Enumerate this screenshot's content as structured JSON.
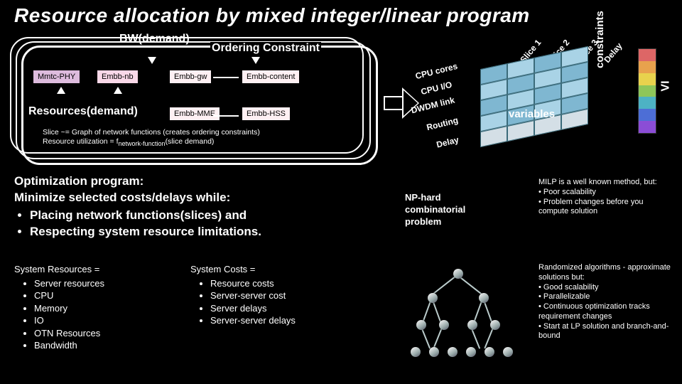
{
  "title": "Resource allocation by mixed integer/linear program",
  "panel": {
    "bw_label": "BW(demand)",
    "ordering_label": "Ordering Constraint",
    "resources_label": "Resources(demand)",
    "nodes": {
      "mmtc": "Mmtc-PHY",
      "nb": "Embb-nb",
      "gw": "Embb-gw",
      "content": "Embb-content",
      "mme": "Embb-MME",
      "hss": "Embb-HSS"
    },
    "note_line1": "Slice ~= Graph of network functions (creates ordering constraints)",
    "note_line2_a": "Resource utilization = f",
    "note_line2_sub": "network-function",
    "note_line2_b": "(slice demand)"
  },
  "grid3d": {
    "cols": {
      "s1": "Slice 1",
      "s2": "Slice 2",
      "s3": "Slice 3",
      "delay": "Delay"
    },
    "rows": {
      "r1": "CPU cores",
      "r2": "CPU I/O",
      "r3": "DWDM link",
      "r4": "Routing",
      "r5": "Delay"
    },
    "variables": "variables",
    "constraints": "constraints",
    "vi": "VI"
  },
  "opt": {
    "heading1": "Optimization program:",
    "heading2": "Minimize selected costs/delays while:",
    "b1": "Placing network functions(slices) and",
    "b2": "Respecting system resource limitations."
  },
  "sysres": {
    "title": "System Resources =",
    "items": [
      "Server resources",
      "CPU",
      "Memory",
      "IO",
      "OTN Resources",
      "Bandwidth"
    ]
  },
  "syscost": {
    "title": "System Costs =",
    "items": [
      "Resource costs",
      "Server-server cost",
      "Server delays",
      "Server-server delays"
    ]
  },
  "nphard": {
    "l1": "NP-hard",
    "l2": "combinatorial",
    "l3": "problem"
  },
  "milp": {
    "l1": "MILP is a well known method, but:",
    "b1": "• Poor scalability",
    "b2": "• Problem changes before you compute solution"
  },
  "rand": {
    "l1": "Randomized algorithms - approximate solutions but:",
    "b1": "• Good scalability",
    "b2": "• Parallelizable",
    "b3": "• Continuous optimization tracks requirement changes",
    "b4": "• Start at LP solution and branch-and-bound"
  }
}
